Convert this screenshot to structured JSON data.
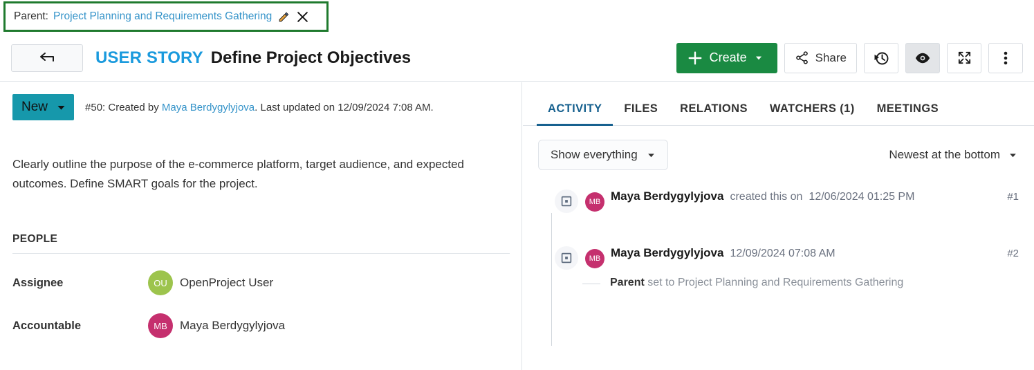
{
  "parent_bar": {
    "label": "Parent:",
    "link_text": "Project Planning and Requirements Gathering",
    "edit_icon": "pencil-icon",
    "close_icon": "close-icon",
    "border_color": "#1f7a2e"
  },
  "header": {
    "back_icon": "arrow-left-icon",
    "type_label": "USER STORY",
    "subject": "Define Project Objectives",
    "type_color": "#1a9add",
    "toolbar": {
      "create_label": "Create",
      "create_color": "#1a8a42",
      "share_label": "Share",
      "history_icon": "time-history-icon",
      "watch_icon": "eye-icon",
      "fullscreen_icon": "fullscreen-icon",
      "more_icon": "vertical-dots-icon"
    }
  },
  "left_panel": {
    "status": {
      "label": "New",
      "color": "#1698ab"
    },
    "meta": {
      "prefix": "#50: Created by ",
      "author": "Maya Berdygylyjova",
      "suffix": ". Last updated on 12/09/2024 7:08 AM."
    },
    "description": "Clearly outline the purpose of the e-commerce platform, target audience, and expected outcomes. Define SMART goals for the project.",
    "people_section": {
      "title": "PEOPLE",
      "fields": [
        {
          "label": "Assignee",
          "value": "OpenProject User",
          "initials": "OU",
          "avatar_color": "#9dc44d"
        },
        {
          "label": "Accountable",
          "value": "Maya Berdygylyjova",
          "initials": "MB",
          "avatar_color": "#c5306e"
        }
      ]
    }
  },
  "right_panel": {
    "tabs": [
      {
        "label": "ACTIVITY",
        "active": true
      },
      {
        "label": "FILES",
        "active": false
      },
      {
        "label": "RELATIONS",
        "active": false
      },
      {
        "label": "WATCHERS (1)",
        "active": false
      },
      {
        "label": "MEETINGS",
        "active": false
      }
    ],
    "filter": {
      "show_label": "Show everything",
      "sort_label": "Newest at the bottom"
    },
    "activities": [
      {
        "initials": "MB",
        "avatar_color": "#c5306e",
        "user": "Maya Berdygylyjova",
        "action": "created this on",
        "time": "12/06/2024 01:25 PM",
        "number": "#1",
        "detail_prefix": "",
        "detail_bold": "",
        "detail_mid": "",
        "detail_value": ""
      },
      {
        "initials": "MB",
        "avatar_color": "#c5306e",
        "user": "Maya Berdygylyjova",
        "action": "",
        "time": "12/09/2024 07:08 AM",
        "number": "#2",
        "detail_bold": "Parent",
        "detail_mid": " set to ",
        "detail_value": "Project Planning and Requirements Gathering"
      }
    ]
  }
}
